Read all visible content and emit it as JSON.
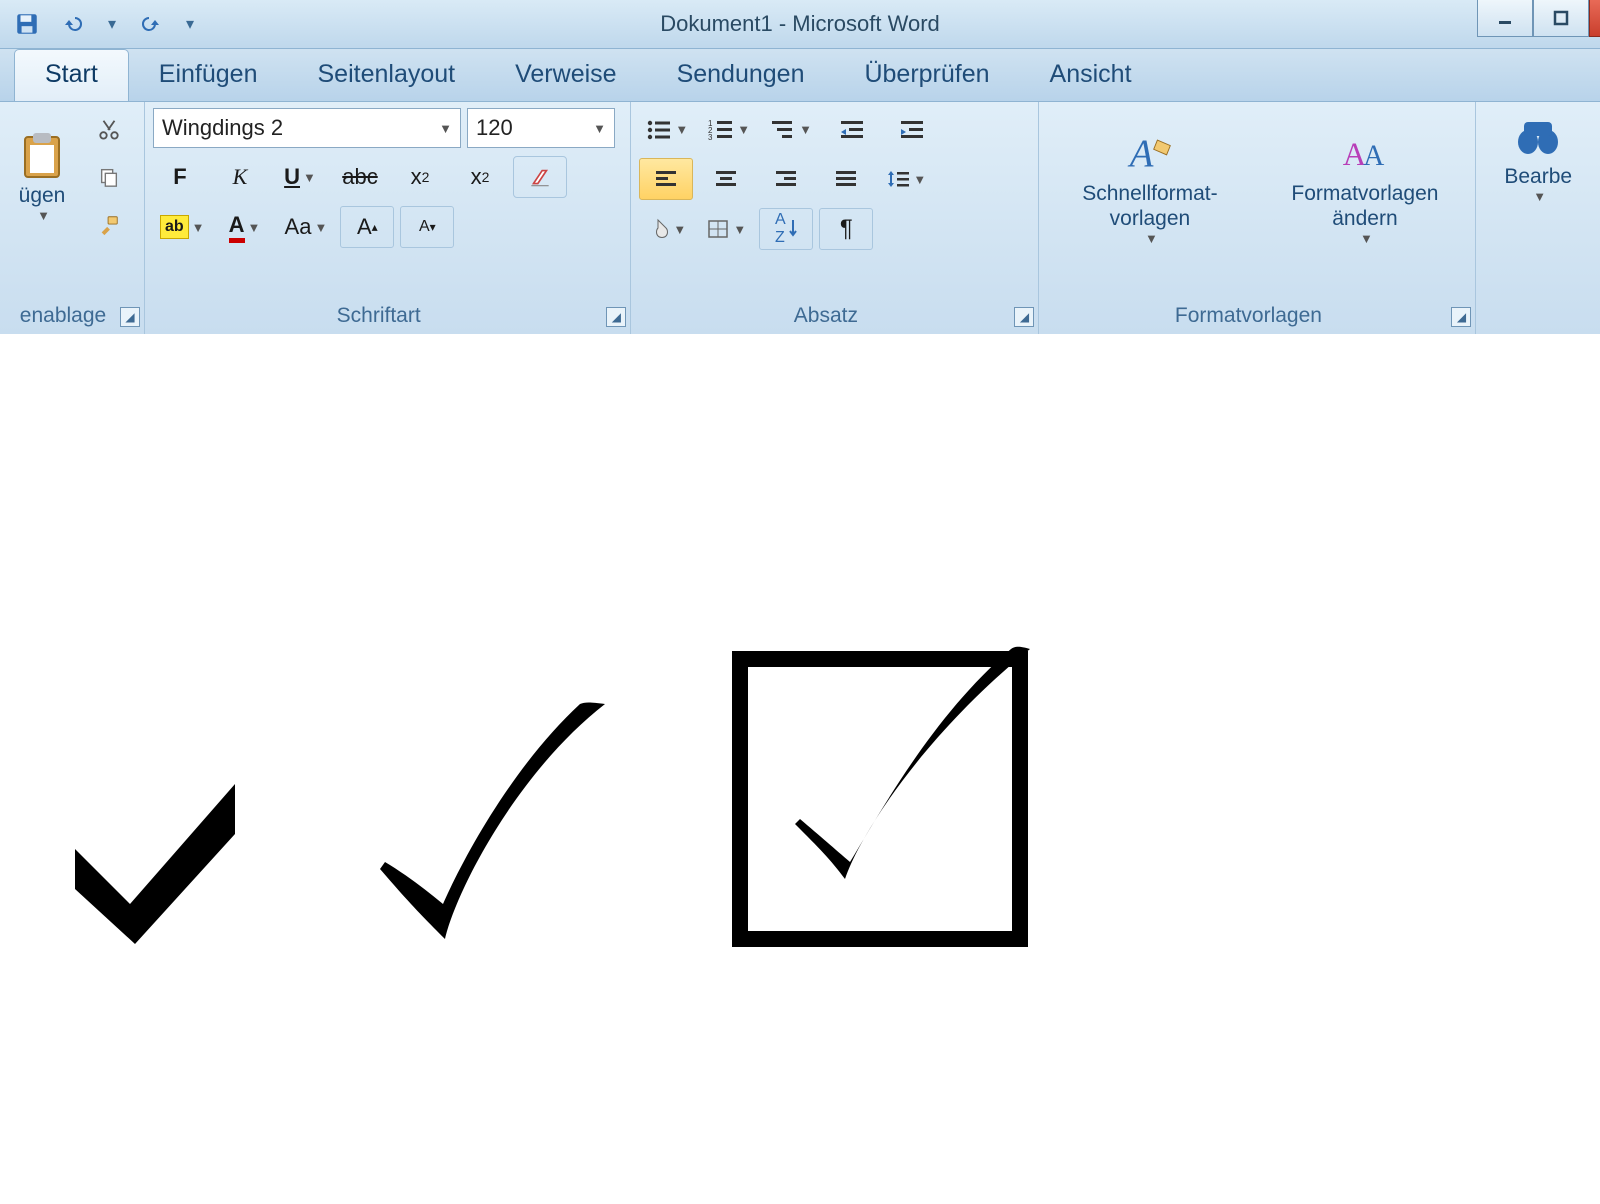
{
  "window": {
    "title": "Dokument1 - Microsoft Word"
  },
  "tabs": {
    "start": "Start",
    "insert": "Einfügen",
    "layout": "Seitenlayout",
    "references": "Verweise",
    "mailings": "Sendungen",
    "review": "Überprüfen",
    "view": "Ansicht"
  },
  "clipboard": {
    "paste_label": "ügen",
    "group_label": "enablage"
  },
  "font": {
    "name": "Wingdings 2",
    "size": "120",
    "bold": "F",
    "italic": "K",
    "change_case": "Aa",
    "group_label": "Schriftart"
  },
  "paragraph": {
    "group_label": "Absatz"
  },
  "styles": {
    "quick_label": "Schnellformat-\nvorlagen",
    "change_label": "Formatvorlagen\nändern",
    "group_label": "Formatvorlagen"
  },
  "editing": {
    "label": "Bearbe"
  }
}
